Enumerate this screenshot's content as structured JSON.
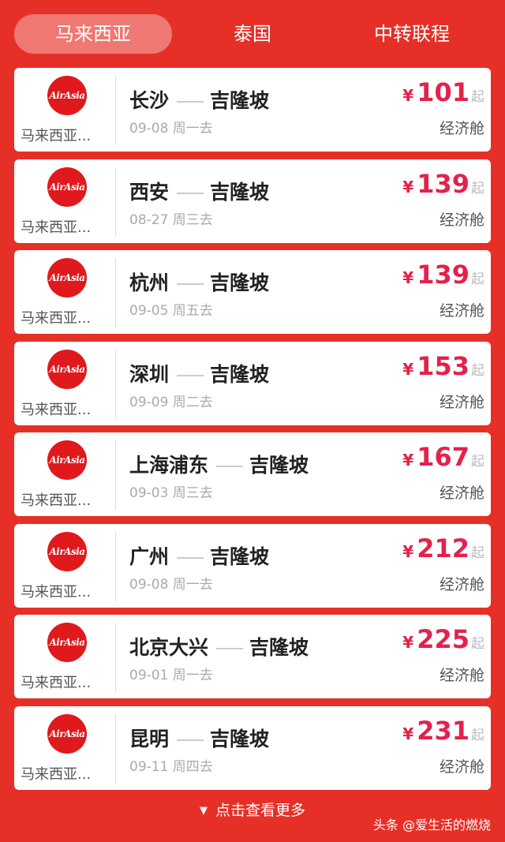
{
  "tabs": [
    "马来西亚",
    "泰国",
    "中转联程"
  ],
  "flights": [
    {
      "airline": "马来西亚...",
      "logo": "AirAsia",
      "from": "长沙",
      "to": "吉隆坡",
      "date": "09-08 周一去",
      "currency": "¥",
      "price": "101",
      "price_suffix": "起",
      "cabin": "经济舱"
    },
    {
      "airline": "马来西亚...",
      "logo": "AirAsia",
      "from": "西安",
      "to": "吉隆坡",
      "date": "08-27 周三去",
      "currency": "¥",
      "price": "139",
      "price_suffix": "起",
      "cabin": "经济舱"
    },
    {
      "airline": "马来西亚...",
      "logo": "AirAsia",
      "from": "杭州",
      "to": "吉隆坡",
      "date": "09-05 周五去",
      "currency": "¥",
      "price": "139",
      "price_suffix": "起",
      "cabin": "经济舱"
    },
    {
      "airline": "马来西亚...",
      "logo": "AirAsia",
      "from": "深圳",
      "to": "吉隆坡",
      "date": "09-09 周二去",
      "currency": "¥",
      "price": "153",
      "price_suffix": "起",
      "cabin": "经济舱"
    },
    {
      "airline": "马来西亚...",
      "logo": "AirAsia",
      "from": "上海浦东",
      "to": "吉隆坡",
      "date": "09-03 周三去",
      "currency": "¥",
      "price": "167",
      "price_suffix": "起",
      "cabin": "经济舱"
    },
    {
      "airline": "马来西亚...",
      "logo": "AirAsia",
      "from": "广州",
      "to": "吉隆坡",
      "date": "09-08 周一去",
      "currency": "¥",
      "price": "212",
      "price_suffix": "起",
      "cabin": "经济舱"
    },
    {
      "airline": "马来西亚...",
      "logo": "AirAsia",
      "from": "北京大兴",
      "to": "吉隆坡",
      "date": "09-01 周一去",
      "currency": "¥",
      "price": "225",
      "price_suffix": "起",
      "cabin": "经济舱"
    },
    {
      "airline": "马来西亚...",
      "logo": "AirAsia",
      "from": "昆明",
      "to": "吉隆坡",
      "date": "09-11 周四去",
      "currency": "¥",
      "price": "231",
      "price_suffix": "起",
      "cabin": "经济舱"
    }
  ],
  "more_label": "点击查看更多",
  "watermark": "头条 @爱生活的燃烧",
  "colors": {
    "background": "#e63027",
    "price": "#e3224b",
    "logo": "#e0191d"
  },
  "icons": {
    "more": "chevron-down-icon",
    "logo": "airasia-logo"
  }
}
